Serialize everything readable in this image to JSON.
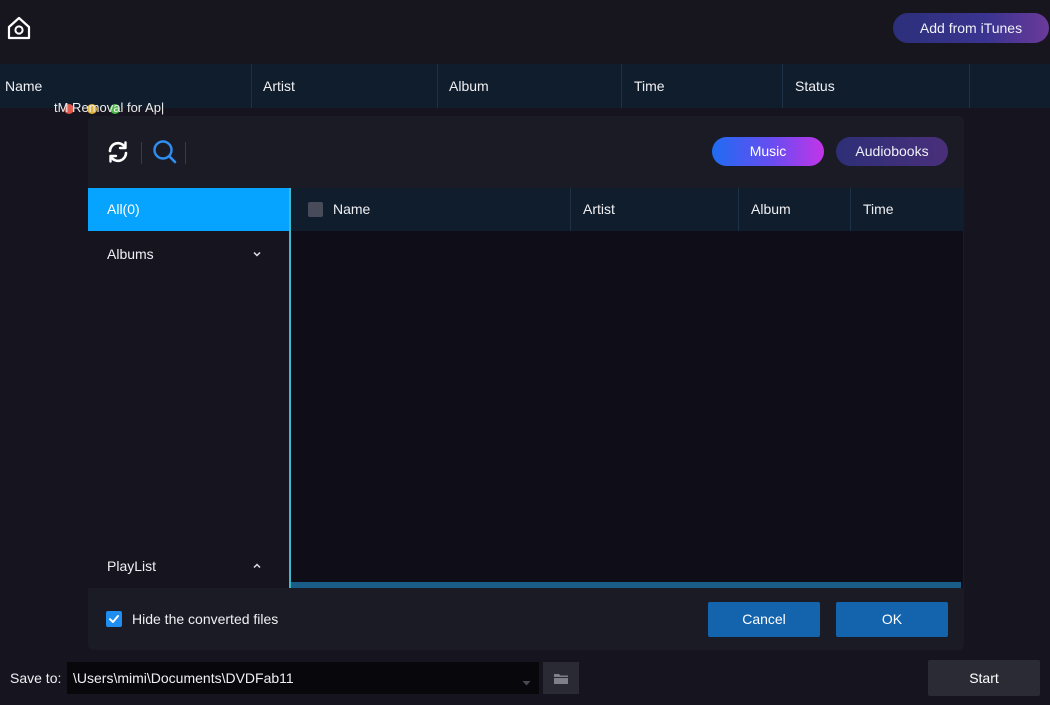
{
  "app": {
    "add_itunes_label": "Add from iTunes",
    "home_icon": "home-icon"
  },
  "main_table": {
    "columns": [
      "Name",
      "Artist",
      "Album",
      "Time",
      "Status"
    ]
  },
  "background_text": "tM Removal for Ap|",
  "dialog": {
    "toolbar": {
      "refresh_icon": "refresh-icon",
      "search_icon": "search-icon",
      "music_label": "Music",
      "audiobooks_label": "Audiobooks",
      "accent": "#06a4ff"
    },
    "sidebar": {
      "all_label": "All(0)",
      "albums_label": "Albums",
      "playlist_label": "PlayList"
    },
    "table": {
      "columns": [
        "Name",
        "Artist",
        "Album",
        "Time"
      ],
      "rows": []
    },
    "footer": {
      "hide_converted_label": "Hide the converted files",
      "hide_converted_checked": true,
      "cancel_label": "Cancel",
      "ok_label": "OK"
    }
  },
  "bottom": {
    "save_to_label": "Save to:",
    "path_value": "\\Users\\mimi\\Documents\\DVDFab11",
    "folder_icon": "folder-icon",
    "start_label": "Start"
  }
}
